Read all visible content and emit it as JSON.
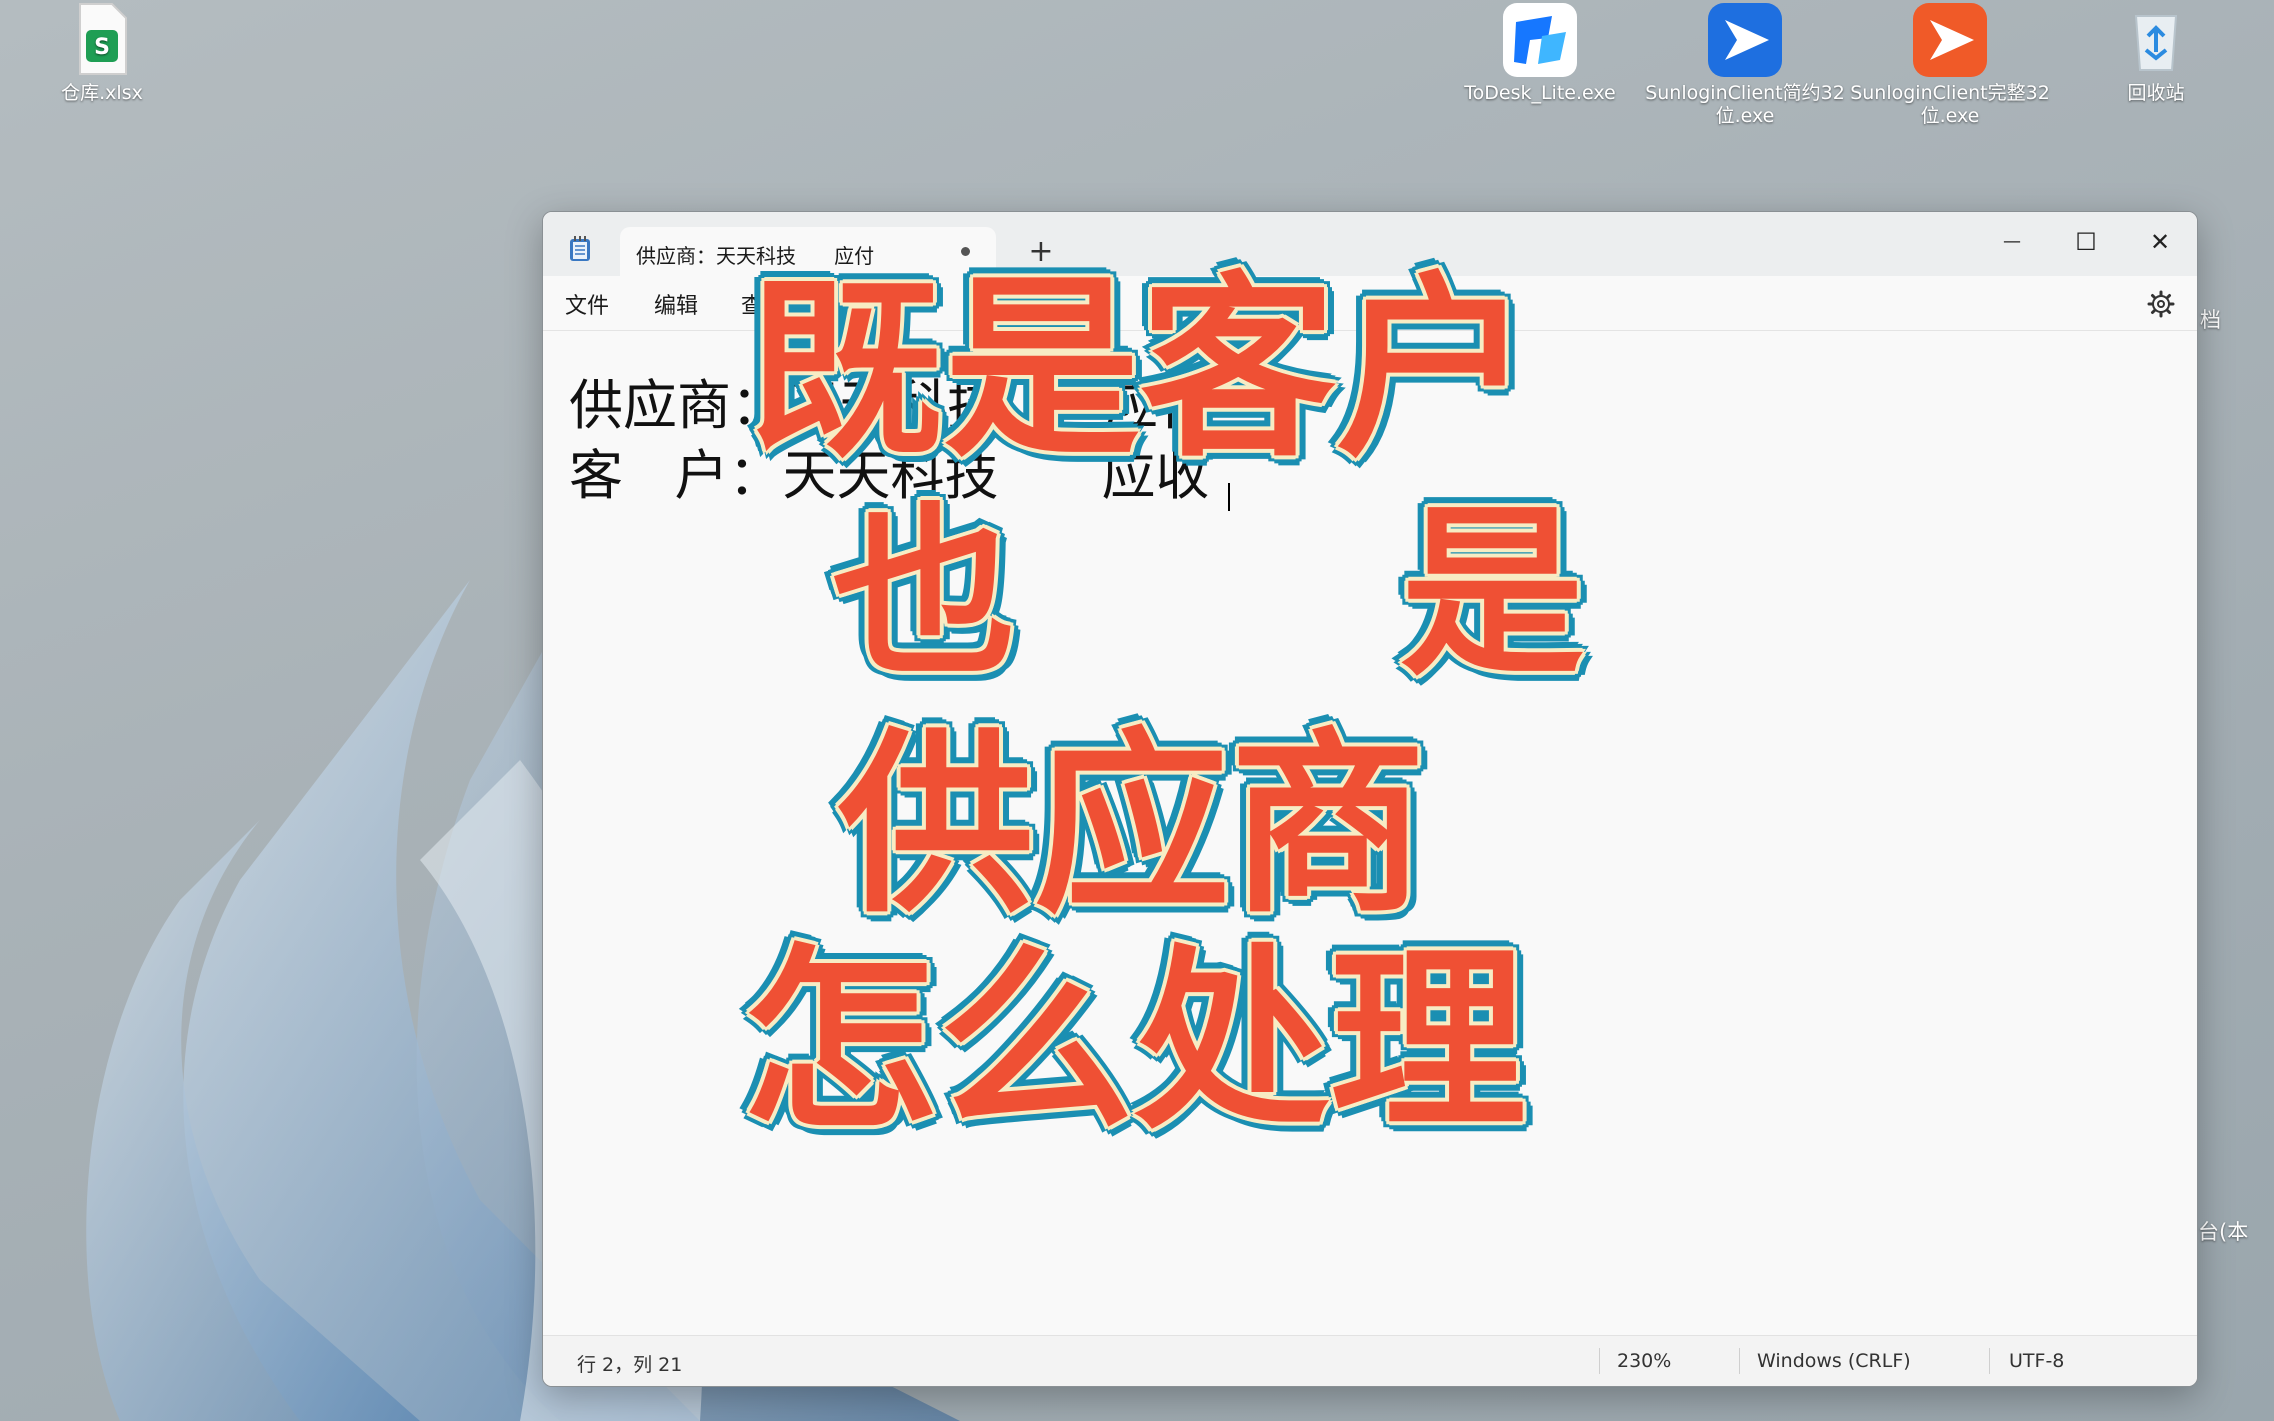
{
  "desktop": {
    "icons": [
      {
        "label": "仓库.xlsx",
        "icon": "spreadsheet-file-icon"
      },
      {
        "label": "ToDesk_Lite.exe",
        "icon": "todesk-app-icon"
      },
      {
        "label": "SunloginClient简约32位.exe",
        "icon": "sunlogin-blue-app-icon"
      },
      {
        "label": "SunloginClient完整32位.exe",
        "icon": "sunlogin-orange-app-icon"
      },
      {
        "label": "回收站",
        "icon": "recycle-bin-icon"
      }
    ],
    "edge_labels": [
      "档",
      "台(本"
    ]
  },
  "window": {
    "tab_title": "供应商：天天科技      应付",
    "tab_modified": true,
    "new_tab_label": "+",
    "controls": {
      "minimize": "—",
      "maximize": "☐",
      "close": "✕"
    },
    "menu": [
      "文件",
      "编辑",
      "查看"
    ],
    "content_lines": [
      "供应商：天天科技      应付",
      "客   户：天天科技      应收"
    ],
    "status": {
      "position": "行 2，列 21",
      "zoom": "230%",
      "line_ending": "Windows (CRLF)",
      "encoding": "UTF-8"
    }
  },
  "overlay_caption": [
    "既是客户",
    "也      是",
    "供应商",
    "怎么处理"
  ],
  "colors": {
    "caption_fill": "#ef5034",
    "caption_inner_stroke": "#f7ecc4",
    "caption_outer_stroke": "#1b8fb2",
    "sheets_green": "#1e9e54",
    "todesk_blue": "#1677ff",
    "sunlogin_blue": "#1e6fe0",
    "sunlogin_orange": "#f05a28"
  }
}
